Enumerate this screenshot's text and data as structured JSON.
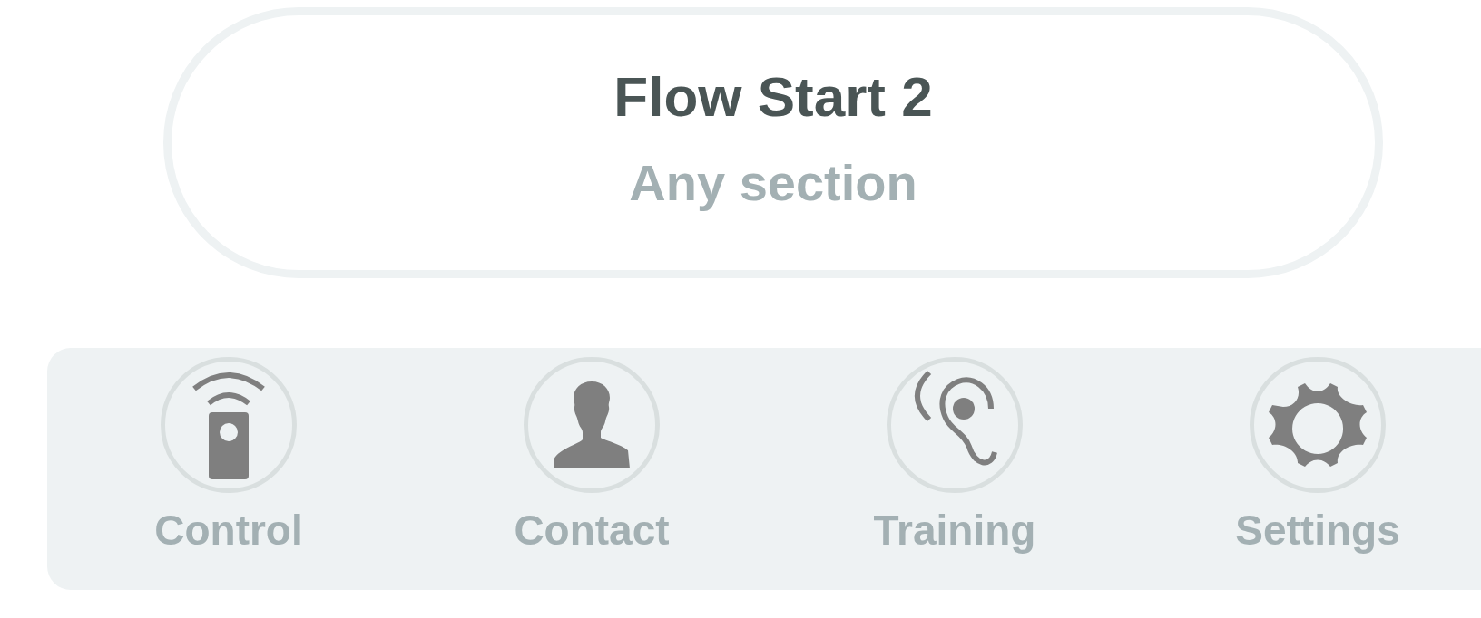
{
  "header": {
    "title": "Flow Start 2",
    "subtitle": "Any section"
  },
  "menu": [
    {
      "kind": "remote",
      "label": "Control"
    },
    {
      "kind": "person",
      "label": "Contact"
    },
    {
      "kind": "ear",
      "label": "Training"
    },
    {
      "kind": "gear",
      "label": "Settings"
    }
  ]
}
